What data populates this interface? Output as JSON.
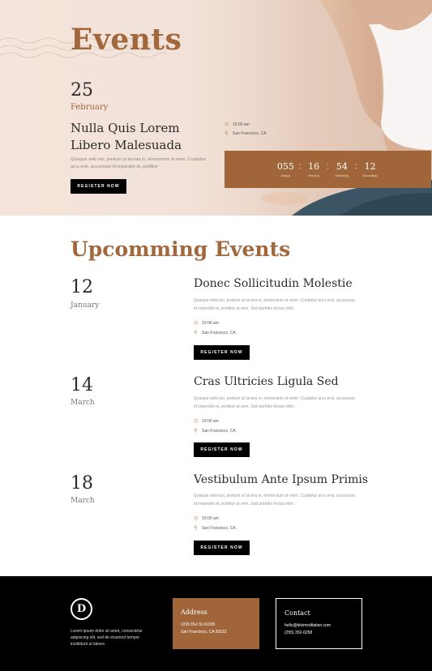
{
  "hero": {
    "title": "Events",
    "day": "25",
    "month": "February",
    "event_name": "Nulla Quis Lorem Libero Malesuada",
    "description": "Quisque velit nisi, pretium ut lacinia in, elementum id enim. Curabitur arcu erat, accumsan id imperdiet et, porttitor",
    "time": "10:00 am",
    "location": "San Francisco, CA",
    "button_label": "REGISTER NOW",
    "countdown": [
      {
        "value": "055",
        "label": "Day(s)"
      },
      {
        "value": "16",
        "label": "Hour(s)"
      },
      {
        "value": "54",
        "label": "Minute(s)"
      },
      {
        "value": "12",
        "label": "Second(s)"
      }
    ]
  },
  "upcoming": {
    "title": "Upcomming Events",
    "events": [
      {
        "day": "12",
        "month": "January",
        "title": "Donec Sollicitudin Molestie",
        "description": "Quisque velit nisi, pretium ut lacinia in, elementum id enim. Curabitur arcu erat, accumsan id imperdiet et, porttitor at sem. Sed porttitor lectus nibh.",
        "time": "10:00 am",
        "location": "San Francisco, CA",
        "button_label": "REGISTER NOW"
      },
      {
        "day": "14",
        "month": "March",
        "title": "Cras Ultricies Ligula Sed",
        "description": "Quisque velit nisi, pretium ut lacinia in, elementum id enim. Curabitur arcu erat, accumsan id imperdiet et, porttitor at sem. Sed porttitor lectus nibh.",
        "time": "10:00 am",
        "location": "San Francisco, CA",
        "button_label": "REGISTER NOW"
      },
      {
        "day": "18",
        "month": "March",
        "title": "Vestibulum Ante Ipsum Primis",
        "description": "Quisque velit nisi, pretium ut lacinia in, elementum id enim. Curabitur arcu erat, accumsan id imperdiet et, porttitor at sem. Sed porttitor lectus nibh.",
        "time": "10:00 am",
        "location": "San Francisco, CA",
        "button_label": "REGISTER NOW"
      }
    ]
  },
  "footer": {
    "logo_letter": "D",
    "text": "Lorem ipsum dolor sit amet, consectetur adipiscing elit, sed do eiusmod tempor incididunt ut labore.",
    "address_heading": "Address",
    "address_line1": "1235 Divi St #1000",
    "address_line2": "San Francisco, CA 93152",
    "contact_heading": "Contact",
    "contact_email": "hello@divimeditation.com",
    "contact_phone": "(255) 352-6258"
  },
  "colors": {
    "accent": "#a0663a",
    "dark": "#000000"
  },
  "icons": {
    "time": "clock-icon",
    "location": "map-pin-icon"
  }
}
